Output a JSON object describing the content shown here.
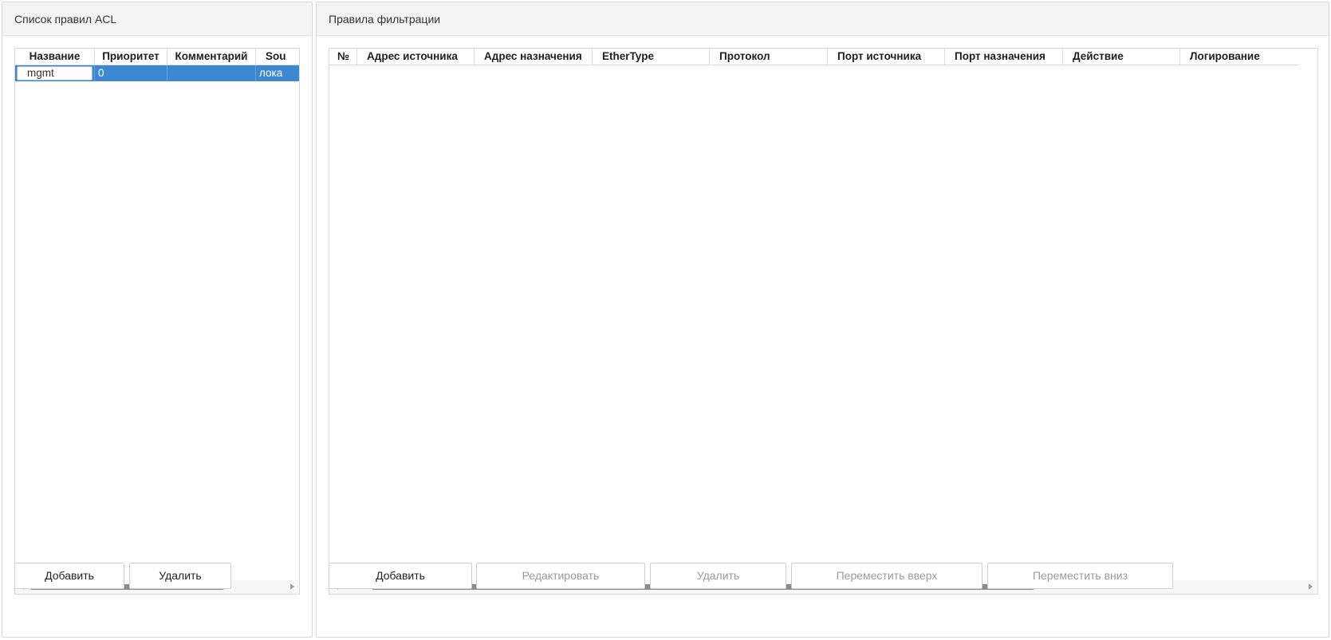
{
  "acl_panel": {
    "title": "Список правил ACL",
    "columns": [
      "Название",
      "Приоритет",
      "Комментарий",
      "Sou"
    ],
    "rows": [
      {
        "name": "mgmt",
        "priority": "0",
        "comment": "",
        "source": "лока"
      }
    ],
    "buttons": {
      "add": "Добавить",
      "delete": "Удалить"
    }
  },
  "filter_panel": {
    "title": "Правила фильтрации",
    "columns": [
      "№",
      "Адрес источника",
      "Адрес назначения",
      "EtherType",
      "Протокол",
      "Порт источника",
      "Порт назначения",
      "Действие",
      "Логирование"
    ],
    "rows": [],
    "buttons": {
      "add": "Добавить",
      "edit": "Редактировать",
      "delete": "Удалить",
      "move_up": "Переместить вверх",
      "move_down": "Переместить вниз"
    }
  },
  "colors": {
    "selection": "#3d87d0",
    "scroll_thumb": "#8c8c8c"
  }
}
